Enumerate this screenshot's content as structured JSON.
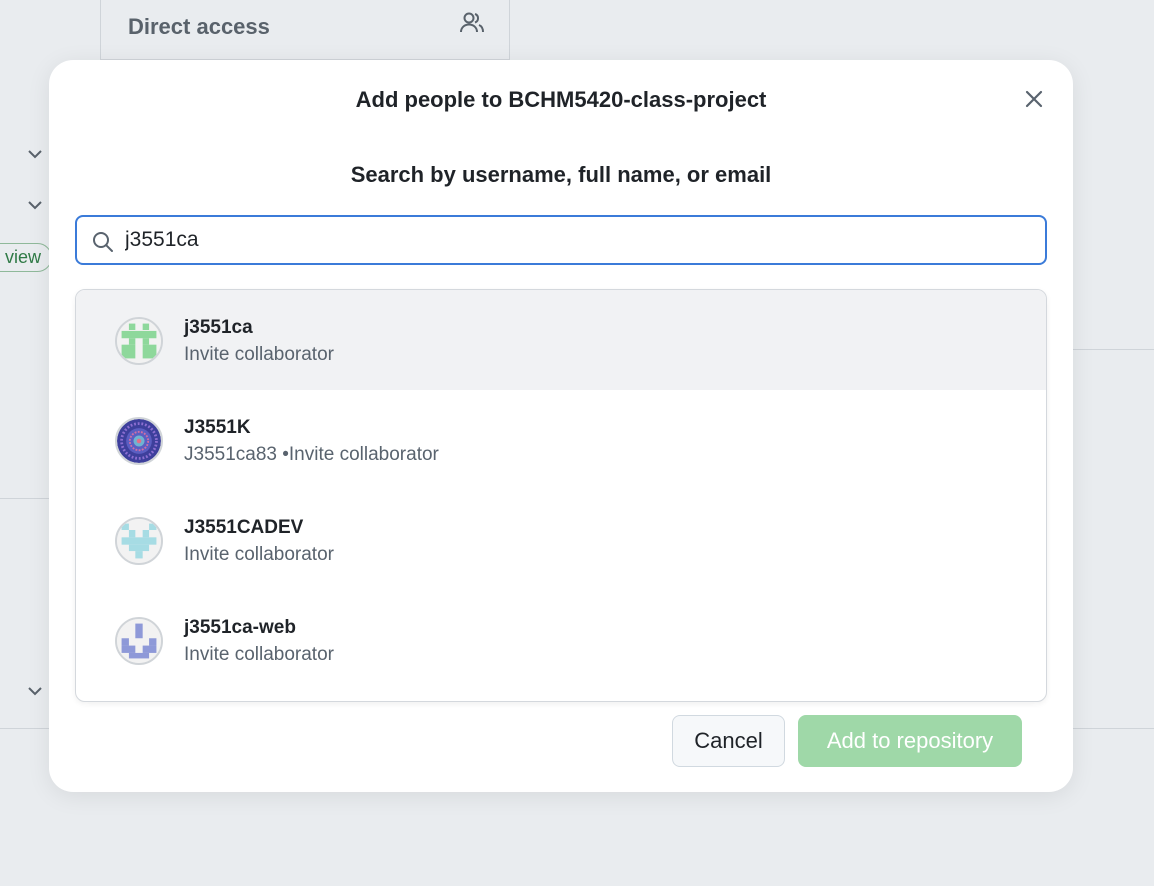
{
  "background": {
    "panel_title": "Direct access",
    "pill_label": "view"
  },
  "modal": {
    "title": "Add people to BCHM5420-class-project",
    "search_heading": "Search by username, full name, or email",
    "search_value": "j3551ca",
    "results": [
      {
        "name": "j3551ca",
        "subtitle": "Invite collaborator",
        "avatar_color": "#8ed89b"
      },
      {
        "name": "J3551K",
        "subtitle": "J3551ca83 •Invite collaborator",
        "avatar_color": "#4a4fb0"
      },
      {
        "name": "J3551CADEV",
        "subtitle": "Invite collaborator",
        "avatar_color": "#a6dce4"
      },
      {
        "name": "j3551ca-web",
        "subtitle": "Invite collaborator",
        "avatar_color": "#8e99d8"
      }
    ],
    "cancel_label": "Cancel",
    "add_label": "Add to repository"
  },
  "icons": {
    "close": "close-icon",
    "search": "search-icon",
    "people": "people-icon",
    "chevron": "chevron-down-icon"
  },
  "colors": {
    "focus_border": "#3b7bd9",
    "primary_disabled": "#9fd8a8",
    "page_backdrop": "#e9ecef"
  }
}
